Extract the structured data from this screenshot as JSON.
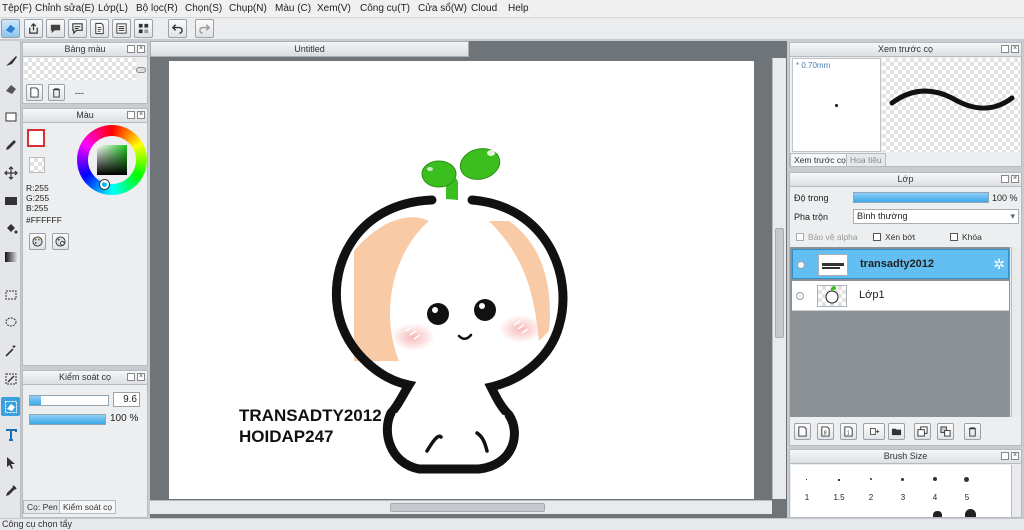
{
  "menu": [
    "Tệp(F)",
    "Chỉnh sửa(E)",
    "Lớp(L)",
    "Bộ lọc(R)",
    "Chọn(S)",
    "Chụp(N)",
    "Màu (C)",
    "Xem(V)",
    "Công cụ(T)",
    "Cửa sổ(W)",
    "Cloud",
    "Help"
  ],
  "document": {
    "tab_title": "Untitled"
  },
  "panels": {
    "swatch": {
      "title": "Bảng màu",
      "page_label": "---"
    },
    "color": {
      "title": "Màu",
      "r": "R:255",
      "g": "G:255",
      "b": "B:255",
      "hex": "#FFFFFF",
      "main_color": "#d83030",
      "accent": "#3aa0e0"
    },
    "brush_control": {
      "title": "Kiểm soát cọ",
      "size": "9.6",
      "size_fraction": 0.14,
      "opacity": "100 %",
      "opacity_fraction": 1.0,
      "tab_pen": "Cọ: Pen",
      "tab_control": "Kiểm soát cọ"
    },
    "brush_preview": {
      "title": "Xem trước cọ",
      "size_label": "0.70mm",
      "tab_preview": "Xem trước cọ",
      "tab_pattern": "Hoa tiêu"
    },
    "layer": {
      "title": "Lớp",
      "opacity_label": "Độ trong",
      "opacity_value": "100 %",
      "blend_label": "Pha trộn",
      "blend_value": "Bình thường",
      "protect_alpha": "Bảo vệ alpha",
      "clipping": "Xén bớt",
      "lock": "Khóa",
      "layers": [
        {
          "name": "transadty2012",
          "selected": true
        },
        {
          "name": "Lớp1",
          "selected": false
        }
      ]
    },
    "brush_size": {
      "title": "Brush Size",
      "sizes": [
        "1",
        "1.5",
        "2",
        "3",
        "4",
        "5"
      ]
    }
  },
  "artwork": {
    "text_line1": "TRANSADTY2012",
    "text_line2": "HOIDAP247"
  },
  "status": "Công cụ chọn tẩy"
}
